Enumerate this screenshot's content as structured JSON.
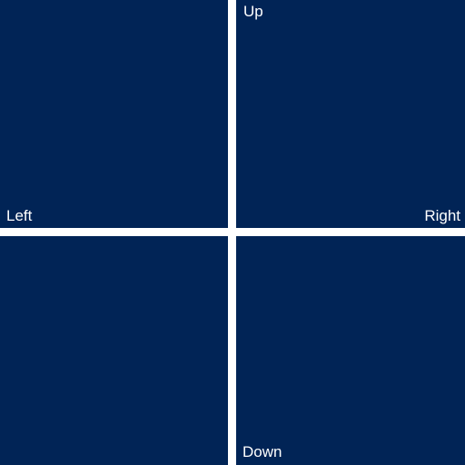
{
  "colors": {
    "panel": "#012456",
    "divider": "#ffffff",
    "text": "#ffffff"
  },
  "panels": {
    "top_left": {
      "label": "Left"
    },
    "top_right": {
      "label": "Up",
      "label_2": "Right"
    },
    "bottom_left": {
      "label": ""
    },
    "bottom_right": {
      "label": "Down"
    }
  }
}
